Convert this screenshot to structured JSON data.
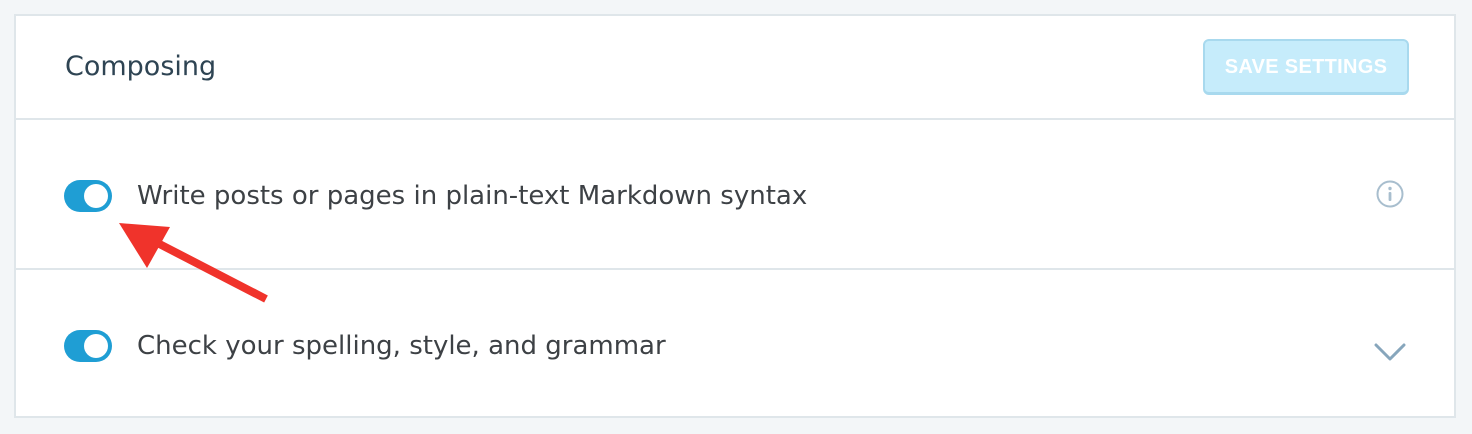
{
  "card": {
    "title": "Composing",
    "save_label": "SAVE SETTINGS"
  },
  "settings": [
    {
      "label": "Write posts or pages in plain-text Markdown syntax",
      "enabled": true,
      "trailing_icon": "info-icon"
    },
    {
      "label": "Check your spelling, style, and grammar",
      "enabled": true,
      "trailing_icon": "chevron-down-icon"
    }
  ],
  "colors": {
    "toggle_on": "#1f9ed4",
    "save_button_disabled": "#c6ecfb",
    "annotation_arrow": "#f0332b"
  }
}
